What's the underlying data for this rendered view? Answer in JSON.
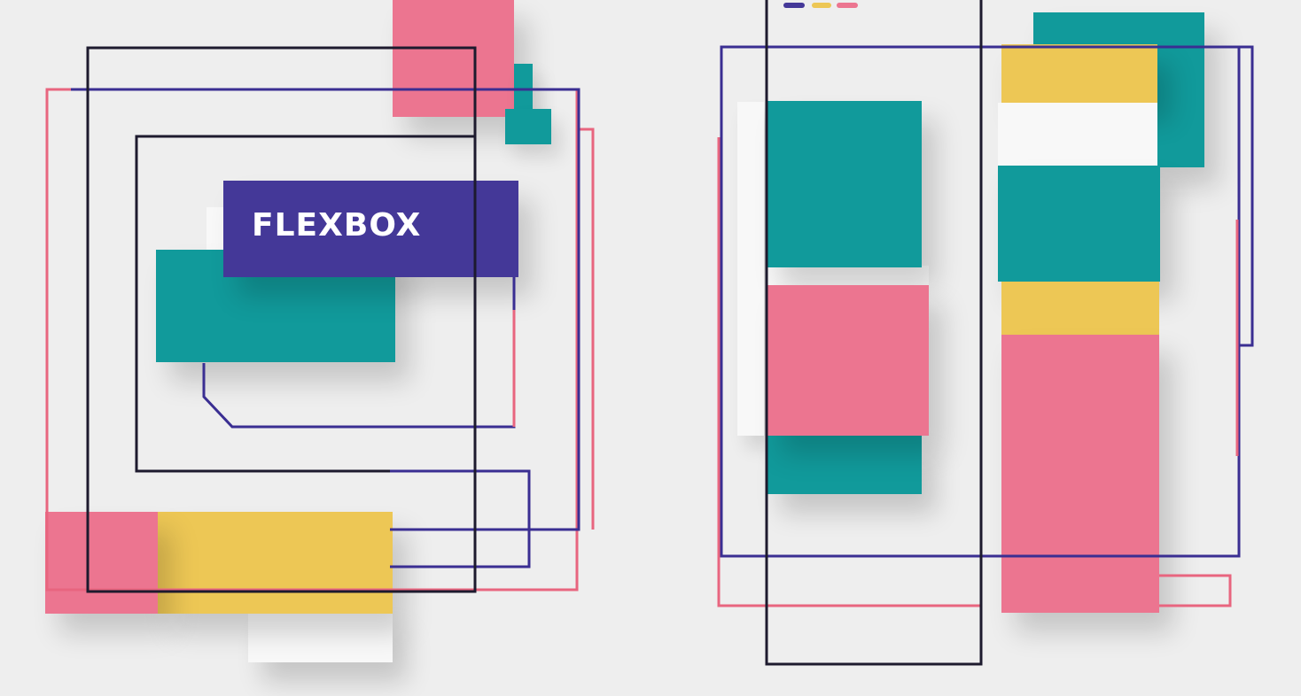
{
  "title": {
    "text": "FLEXBOX"
  },
  "palette": {
    "background": "#eeeeee",
    "teal": "#119a9b",
    "pink": "#ec7590",
    "yellow": "#edc755",
    "indigo": "#443898",
    "white": "#f8f8f8",
    "line_dark": "#1d1a2e",
    "line_navy": "#3a2e92",
    "line_pink": "#e8657f"
  },
  "indicator_dots": [
    {
      "color": "#443898"
    },
    {
      "color": "#edc755"
    },
    {
      "color": "#ec7590"
    }
  ]
}
